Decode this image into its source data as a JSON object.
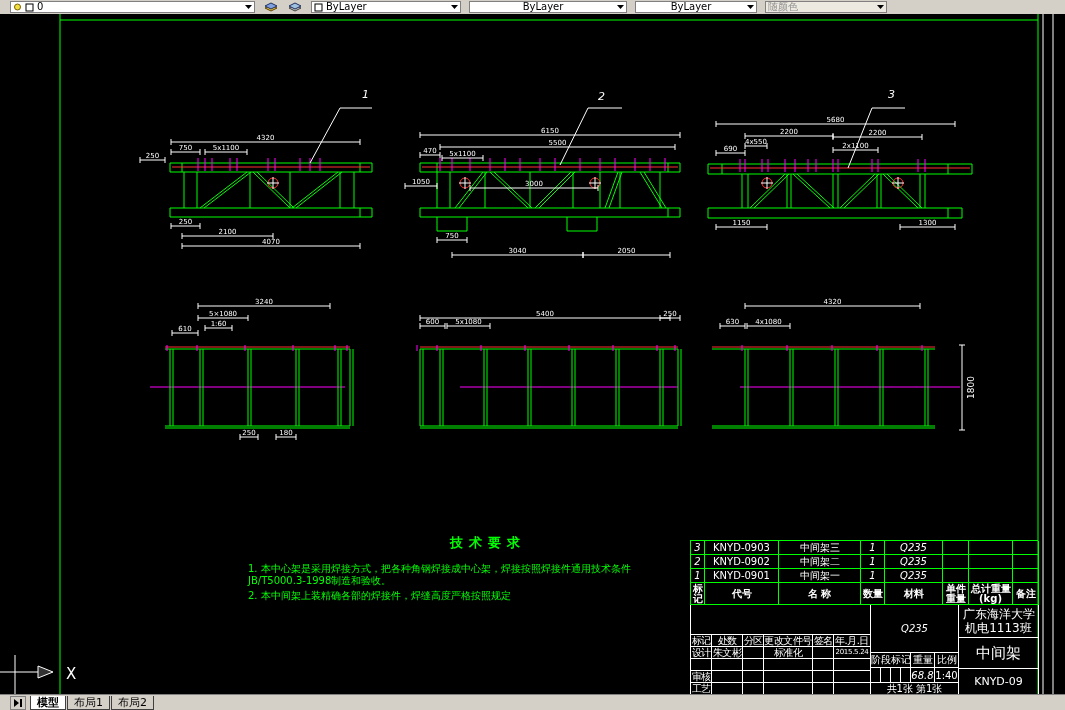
{
  "toolbar": {
    "dropdowns": [
      {
        "kind": "layer",
        "value": "0",
        "disabled": false
      },
      {
        "kind": "color",
        "value": "ByLayer",
        "disabled": false
      },
      {
        "kind": "linetype",
        "value": "ByLayer",
        "disabled": false
      },
      {
        "kind": "lineweight",
        "value": "ByLayer",
        "disabled": false
      },
      {
        "kind": "plotstyle",
        "value": "随颜色",
        "disabled": true
      }
    ]
  },
  "drawing": {
    "views": [
      {
        "part_label": "1",
        "elevation_dimensions": [
          "4320",
          "750",
          "5x1100",
          "250",
          "2100",
          "4070",
          "250"
        ],
        "plan_dimensions": [
          "3240",
          "5×1080",
          "610",
          "1:60",
          "250",
          "180"
        ]
      },
      {
        "part_label": "2",
        "elevation_dimensions": [
          "6150",
          "5500",
          "470",
          "5x1100",
          "1050",
          "3000",
          "750",
          "3040",
          "2050"
        ],
        "plan_dimensions": [
          "5400",
          "600",
          "5x1080",
          "250"
        ]
      },
      {
        "part_label": "3",
        "elevation_dimensions": [
          "5680",
          "2200",
          "2200",
          "690",
          "4x550",
          "2x1100",
          "1150",
          "1300"
        ],
        "plan_dimensions": [
          "4320",
          "630",
          "4x1080",
          "1800"
        ]
      }
    ],
    "technical_requirements": {
      "title": "技术要求",
      "items": [
        "1. 本中心架是采用焊接方式，把各种角钢焊接成中心架，焊接按照焊接件通用技术条件JB/T5000.3-1998制造和验收。",
        "2. 本中间架上装精确各部的焊接件，焊缝高度严格按照规定"
      ]
    },
    "ucs_x_label": "X"
  },
  "title_block": {
    "parts": [
      {
        "index": "3",
        "code": "KNYD-0903",
        "name": "中间架三",
        "quantity": "1",
        "material": "Q235"
      },
      {
        "index": "2",
        "code": "KNYD-0902",
        "name": "中间架二",
        "quantity": "1",
        "material": "Q235"
      },
      {
        "index": "1",
        "code": "KNYD-0901",
        "name": "中间架一",
        "quantity": "1",
        "material": "Q235"
      }
    ],
    "parts_header": [
      "标记",
      "代号",
      "名 称",
      "数量",
      "材料",
      "单件重量",
      "总计重量(kg)",
      "备注"
    ],
    "revision_header": [
      "标记",
      "处数",
      "分区",
      "更改文件号",
      "签名",
      "年.月.日"
    ],
    "design_row": {
      "label": "设计",
      "designer": "朱文彬",
      "standardization": "标准化",
      "date": "2015.5.24"
    },
    "review_label": "审核",
    "process_label": "工艺",
    "material": "Q235",
    "stage_label": "阶段标记",
    "weight_label": "重量",
    "scale_label": "比例",
    "weight": "68.8",
    "scale": "1:40",
    "sheets": "共1张 第1张",
    "school": "广东海洋大学",
    "class": "机电1113班",
    "drawing_name": "中间架",
    "drawing_code": "KNYD-09"
  },
  "tabs": [
    {
      "label": "模型",
      "selected": true
    },
    {
      "label": "布局1",
      "selected": false
    },
    {
      "label": "布局2",
      "selected": false
    }
  ]
}
